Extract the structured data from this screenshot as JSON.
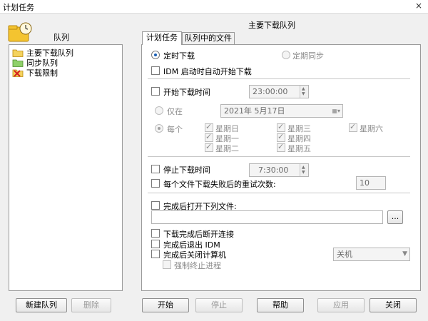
{
  "window": {
    "title": "计划任务",
    "close_label": "×"
  },
  "left": {
    "header": "队列",
    "queues": [
      {
        "label": "主要下载队列",
        "icon": "folder-yellow-icon"
      },
      {
        "label": "同步队列",
        "icon": "folder-green-icon"
      },
      {
        "label": "下载限制",
        "icon": "folder-red-x-icon"
      }
    ],
    "new_queue_label": "新建队列",
    "delete_label": "删除"
  },
  "right": {
    "header": "主要下载队列",
    "tabs": [
      "计划任务",
      "队列中的文件"
    ],
    "schedule": {
      "timed_download": "定时下载",
      "periodic_sync": "定期同步",
      "idm_startup": "IDM 启动时自动开始下载",
      "start_time_label": "开始下载时间",
      "start_time_value": "23:00:00",
      "once_label": "仅在",
      "once_date": "2021年  5月17日",
      "every_label": "每个",
      "days": [
        "星期日",
        "星期一",
        "星期二",
        "星期三",
        "星期四",
        "星期五",
        "星期六"
      ],
      "stop_time_label": "停止下载时间",
      "stop_time_value": "7:30:00",
      "retry_label": "每个文件下载失败后的重试次数:",
      "retry_value": "10",
      "open_file_label": "完成后打开下列文件:",
      "open_file_value": "",
      "browse_label": "...",
      "disconnect_label": "下载完成后断开连接",
      "exit_idm_label": "完成后退出 IDM",
      "shutdown_label": "完成后关闭计算机",
      "shutdown_option": "关机",
      "force_kill_label": "强制终止进程"
    }
  },
  "bottom": {
    "start": "开始",
    "stop": "停止",
    "help": "帮助",
    "apply": "应用",
    "close": "关闭"
  },
  "colors": {
    "accent": "#1a5fb4",
    "window_bg": "#f0f0f0"
  }
}
